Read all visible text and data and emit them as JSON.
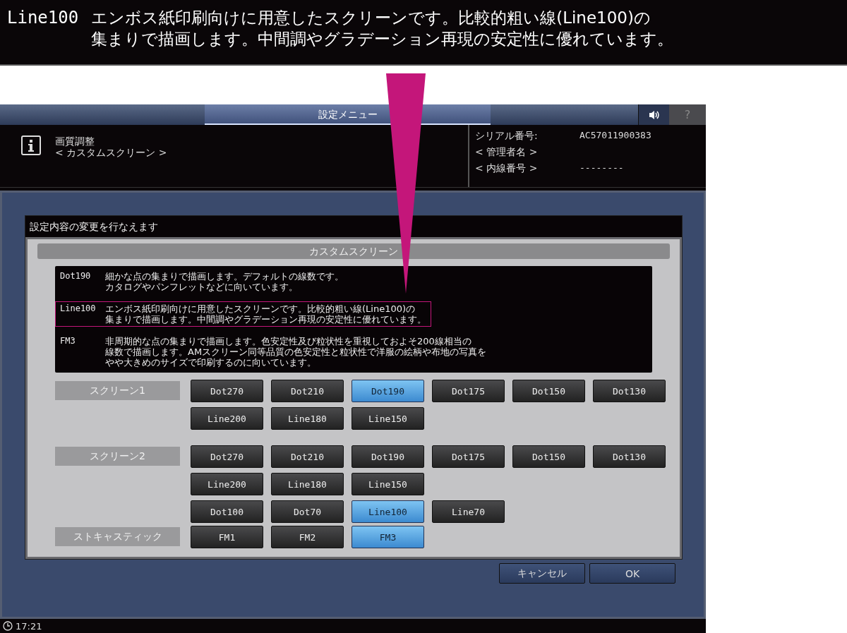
{
  "callout": {
    "term": "Line100",
    "lines": [
      "エンボス紙印刷向けに用意したスクリーンです。比較的粗い線(Line100)の",
      "集まりで描画します。中間調やグラデーション再現の安定性に優れています。"
    ]
  },
  "header": {
    "title": "設定メニュー",
    "help": "?"
  },
  "info": {
    "title": "画質調整",
    "subtitle": "< カスタムスクリーン >",
    "fields": [
      {
        "label": "シリアル番号:",
        "value": "AC57011900383"
      },
      {
        "label": "< 管理者名 >"
      },
      {
        "label": "< 内線番号 >",
        "value": "--------"
      }
    ]
  },
  "dialog": {
    "message": "設定内容の変更を行なえます",
    "title": "カスタムスクリーン",
    "descriptions": [
      {
        "term": "Dot190",
        "lines": [
          "細かな点の集まりで描画します。デフォルトの線数です。",
          "カタログやパンフレットなどに向いています。"
        ],
        "highlighted": false
      },
      {
        "term": "Line100",
        "lines": [
          "エンボス紙印刷向けに用意したスクリーンです。比較的粗い線(Line100)の",
          "集まりで描画します。中間調やグラデーション再現の安定性に優れています。"
        ],
        "highlighted": true
      },
      {
        "term": "FM3",
        "lines": [
          "非周期的な点の集まりで描画します。色安定性及び粒状性を重視しておよそ200線相当の",
          "線数で描画します。AMスクリーン同等品質の色安定性と粒状性で洋服の絵柄や布地の写真を",
          "やや大きめのサイズで印刷するのに向いています。"
        ],
        "highlighted": false
      }
    ],
    "groups": [
      {
        "label": "スクリーン1",
        "rows": [
          [
            {
              "label": "Dot270",
              "selected": false
            },
            {
              "label": "Dot210",
              "selected": false
            },
            {
              "label": "Dot190",
              "selected": true
            },
            {
              "label": "Dot175",
              "selected": false
            },
            {
              "label": "Dot150",
              "selected": false
            },
            {
              "label": "Dot130",
              "selected": false
            }
          ],
          [
            {
              "label": "Line200",
              "selected": false
            },
            {
              "label": "Line180",
              "selected": false
            },
            {
              "label": "Line150",
              "selected": false
            }
          ]
        ]
      },
      {
        "label": "スクリーン2",
        "rows": [
          [
            {
              "label": "Dot270",
              "selected": false
            },
            {
              "label": "Dot210",
              "selected": false
            },
            {
              "label": "Dot190",
              "selected": false
            },
            {
              "label": "Dot175",
              "selected": false
            },
            {
              "label": "Dot150",
              "selected": false
            },
            {
              "label": "Dot130",
              "selected": false
            }
          ],
          [
            {
              "label": "Line200",
              "selected": false
            },
            {
              "label": "Line180",
              "selected": false
            },
            {
              "label": "Line150",
              "selected": false
            }
          ],
          [
            {
              "label": "Dot100",
              "selected": false
            },
            {
              "label": "Dot70",
              "selected": false
            },
            {
              "label": "Line100",
              "selected": true
            },
            {
              "label": "Line70",
              "selected": false
            }
          ]
        ]
      },
      {
        "label": "ストキャスティック",
        "rows": [
          [
            {
              "label": "FM1",
              "selected": false
            },
            {
              "label": "FM2",
              "selected": false
            },
            {
              "label": "FM3",
              "selected": true
            }
          ]
        ]
      }
    ]
  },
  "buttons": [
    "キャンセル",
    "OK"
  ],
  "status_bar": {
    "time": "17:21"
  }
}
